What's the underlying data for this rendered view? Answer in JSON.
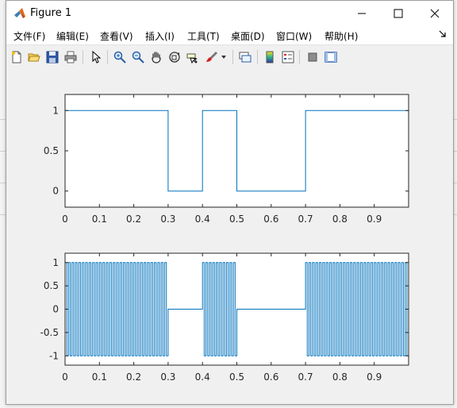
{
  "window": {
    "title": "Figure 1"
  },
  "menu": [
    "文件(F)",
    "编辑(E)",
    "查看(V)",
    "插入(I)",
    "工具(T)",
    "桌面(D)",
    "窗口(W)",
    "帮助(H)"
  ],
  "toolbar_icons": [
    "new-figure-icon",
    "open-file-icon",
    "save-icon",
    "print-icon",
    "pointer-icon",
    "zoom-in-icon",
    "zoom-out-icon",
    "pan-hand-icon",
    "rotate-3d-icon",
    "data-cursor-icon",
    "brush-icon",
    "brush-dropdown-icon",
    "link-plot-icon",
    "colorbar-icon",
    "legend-icon",
    "hide-plot-tools-icon",
    "show-plot-tools-icon"
  ],
  "chart_data": [
    {
      "type": "line",
      "title": "",
      "xlabel": "",
      "ylabel": "",
      "xlim": [
        0,
        1
      ],
      "ylim": [
        -0.2,
        1.2
      ],
      "xticks": [
        "0",
        "0.1",
        "0.2",
        "0.3",
        "0.4",
        "0.5",
        "0.6",
        "0.7",
        "0.8",
        "0.9"
      ],
      "yticks": [
        "0",
        "0.5",
        "1"
      ],
      "series": [
        {
          "color": "#0072bd",
          "x": [
            0,
            0.3,
            0.3,
            0.4,
            0.4,
            0.5,
            0.5,
            0.7,
            0.7,
            1
          ],
          "y": [
            1,
            1,
            0,
            0,
            1,
            1,
            0,
            0,
            1,
            1
          ]
        }
      ],
      "grid": false
    },
    {
      "type": "line",
      "title": "",
      "xlabel": "",
      "ylabel": "",
      "xlim": [
        0,
        1
      ],
      "ylim": [
        -1.2,
        1.2
      ],
      "xticks": [
        "0",
        "0.1",
        "0.2",
        "0.3",
        "0.4",
        "0.5",
        "0.6",
        "0.7",
        "0.8",
        "0.9"
      ],
      "yticks": [
        "-1",
        "-0.5",
        "0",
        "0.5",
        "1"
      ],
      "series": [
        {
          "color": "#0072bd",
          "description": "carrier square wave ±1 gated by the upper signal (on during 0–0.3, 0.4–0.5, 0.7–1; zero elsewhere)",
          "carrier_frequency": 100,
          "gate_on_intervals": [
            [
              0,
              0.3
            ],
            [
              0.4,
              0.5
            ],
            [
              0.7,
              1
            ]
          ]
        }
      ],
      "grid": false
    }
  ]
}
